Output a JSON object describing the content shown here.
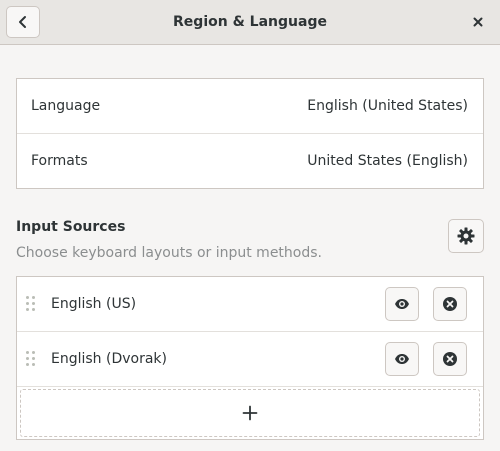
{
  "header": {
    "title": "Region & Language"
  },
  "settings": {
    "rows": [
      {
        "label": "Language",
        "value": "English (United States)"
      },
      {
        "label": "Formats",
        "value": "United States (English)"
      }
    ]
  },
  "input_sources": {
    "title": "Input Sources",
    "subtitle": "Choose keyboard layouts or input methods.",
    "items": [
      {
        "label": "English (US)"
      },
      {
        "label": "English (Dvorak)"
      }
    ]
  },
  "icons": {
    "back": "chevron-left-icon",
    "close": "close-icon",
    "options": "gear-icon",
    "preview": "eye-icon",
    "remove": "remove-circle-icon",
    "add": "plus-icon",
    "drag": "drag-handle-icon"
  },
  "colors": {
    "background": "#f6f5f4",
    "headerbar": "#e8e6e3",
    "border": "#cdc7c2",
    "text": "#2e3436",
    "dim_text": "#8b8e8f"
  }
}
